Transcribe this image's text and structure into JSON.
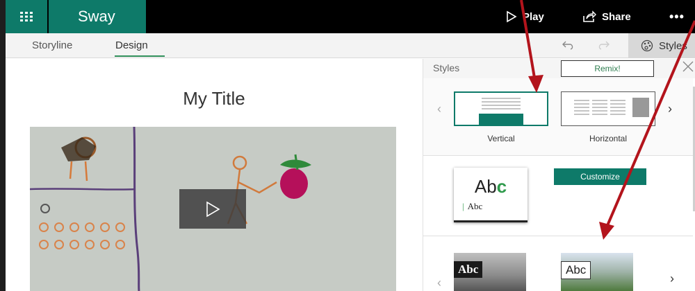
{
  "app": {
    "name": "Sway"
  },
  "topbar": {
    "play_label": "Play",
    "share_label": "Share",
    "more_label": "•••"
  },
  "tabs": [
    {
      "label": "Storyline"
    },
    {
      "label": "Design"
    }
  ],
  "styles_tab_label": "Styles",
  "canvas": {
    "title": "My Title"
  },
  "styles_pane": {
    "title": "Styles",
    "remix_label": "Remix!",
    "customize_label": "Customize",
    "layouts": [
      {
        "label": "Vertical"
      },
      {
        "label": "Horizontal"
      }
    ],
    "theme_card": {
      "big_text_a": "Ab",
      "big_text_b": "c",
      "small_text": "Abc"
    },
    "variants": [
      {
        "label": "Abc"
      },
      {
        "label": "Abc"
      }
    ]
  },
  "colors": {
    "brand": "#0e7a69",
    "accent": "#2f9a4c",
    "annotation_arrow": "#b3141c"
  },
  "icons": {
    "waffle": "waffle-icon",
    "play": "play-icon",
    "share": "share-icon",
    "undo": "undo-icon",
    "redo": "redo-icon",
    "styles": "palette-icon",
    "close": "close-icon"
  }
}
